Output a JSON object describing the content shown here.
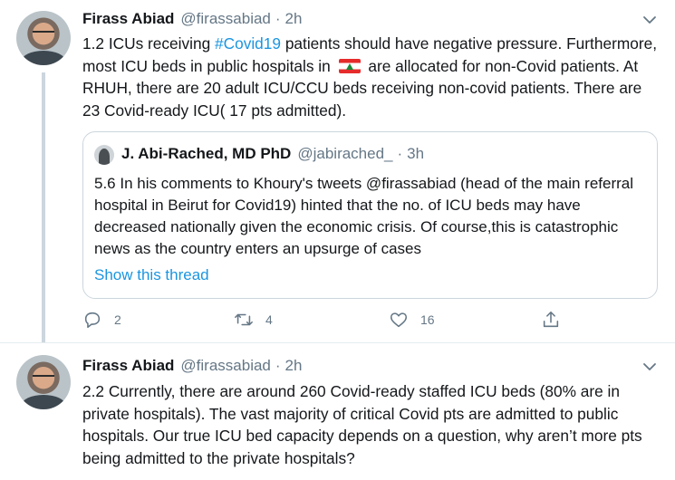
{
  "tweets": [
    {
      "author": {
        "name": "Firass Abiad",
        "handle": "@firassabiad",
        "time": "2h"
      },
      "text": {
        "part1": "1.2 ICUs receiving ",
        "hashtag": "#Covid19",
        "part2": " patients should have negative pressure. Furthermore, most ICU beds in public hospitals in ",
        "part3": " are allocated for non-Covid patients. At RHUH, there are 20 adult ICU/CCU beds receiving non-covid patients. There are 23 Covid-ready ICU( 17 pts admitted)."
      },
      "flag_icon": "lebanon-flag-emoji",
      "quote": {
        "author": {
          "name": "J. Abi-Rached, MD PhD",
          "handle": "@jabirached_",
          "time": "3h"
        },
        "text": "5.6 In his comments to Khoury's tweets @firassabiad (head of the main referral hospital in Beirut for Covid19) hinted that the no. of ICU beds may have decreased nationally given the economic crisis. Of course,this is catastrophic news as the country enters an upsurge of cases",
        "show_thread": "Show this thread"
      },
      "actions": {
        "replies": "2",
        "retweets": "4",
        "likes": "16"
      }
    },
    {
      "author": {
        "name": "Firass Abiad",
        "handle": "@firassabiad",
        "time": "2h"
      },
      "text": "2.2 Currently, there are around 260 Covid-ready staffed ICU beds (80% are in private hospitals). The vast majority of critical Covid pts are admitted to public hospitals. Our true ICU bed capacity depends on a question, why aren’t more pts being admitted to the private hospitals?"
    }
  ],
  "colors": {
    "link": "#1b95e0",
    "secondary": "#657786",
    "border": "#ccd6dd",
    "thread_line": "#ccd6dd"
  },
  "separator": "·"
}
